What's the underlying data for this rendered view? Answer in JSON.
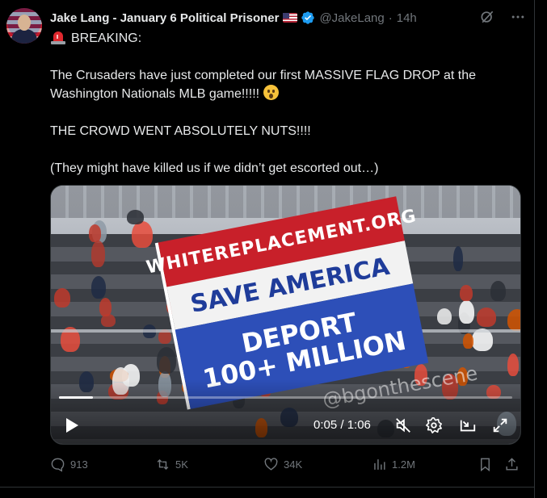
{
  "tweet": {
    "author_name": "Jake Lang - January 6 Political Prisoner",
    "handle": "@JakeLang",
    "separator": "·",
    "time_ago": "14h",
    "lines": [
      "BREAKING:",
      "The Crusaders have just completed our first MASSIVE FLAG DROP at the Washington Nationals MLB game!!!!!",
      "THE CROWD WENT ABSOLUTELY NUTS!!!!",
      "(They might have killed us if we didn’t get escorted out…)"
    ],
    "icons": {
      "avatar": "avatar",
      "flag": "us-flag-emoji",
      "verified": "verified-badge-icon",
      "siren": "siren-emoji",
      "astonished": "astonished-face-emoji",
      "grok": "grok-icon",
      "more": "more-icon"
    }
  },
  "media": {
    "banner": {
      "line1": "WHITEREPLACEMENT.ORG",
      "line2": "SAVE AMERICA",
      "line3": "DEPORT",
      "line4": "100+ MILLION"
    },
    "watermark": "@bgonthescene",
    "player": {
      "time_display": "0:05 / 1:06",
      "progress_fraction": 0.075
    }
  },
  "actions": {
    "replies": "913",
    "reposts": "5K",
    "likes": "34K",
    "views": "1.2M"
  },
  "colors": {
    "background": "#000000",
    "text": "#e7e9ea",
    "muted": "#71767b",
    "verified": "#1d9bf0",
    "border": "#2f3336"
  }
}
